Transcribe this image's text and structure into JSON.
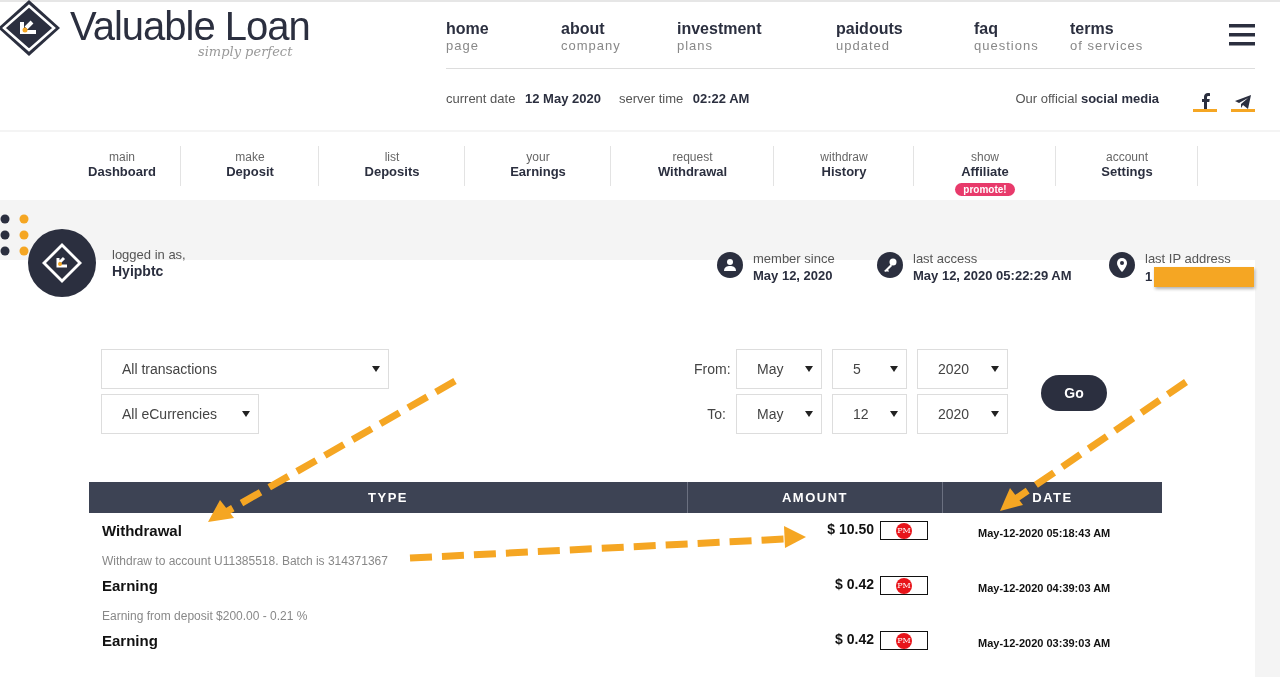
{
  "logo": {
    "name": "Valuable Loan",
    "tagline": "simply perfect"
  },
  "top_nav": [
    {
      "title": "home",
      "subtitle": "page"
    },
    {
      "title": "about",
      "subtitle": "company"
    },
    {
      "title": "investment",
      "subtitle": "plans"
    },
    {
      "title": "paidouts",
      "subtitle": "updated"
    },
    {
      "title": "faq",
      "subtitle": "questions"
    },
    {
      "title": "terms",
      "subtitle": "of services"
    }
  ],
  "info": [
    {
      "label": "current date",
      "value": "12 May 2020"
    },
    {
      "label": "server time",
      "value": "02:22 AM"
    }
  ],
  "social": {
    "text": "Our official **social media**",
    "icons": [
      {
        "kind": "facebook"
      },
      {
        "kind": "telegram"
      }
    ]
  },
  "account_nav": [
    {
      "top": "main",
      "bottom": "Dashboard"
    },
    {
      "top": "make",
      "bottom": "Deposit"
    },
    {
      "top": "list",
      "bottom": "Deposits"
    },
    {
      "top": "your",
      "bottom": "Earnings"
    },
    {
      "top": "request",
      "bottom": "Withdrawal"
    },
    {
      "top": "withdraw",
      "bottom": "History"
    },
    {
      "top": "show",
      "bottom": "Affiliate",
      "badge": "promote!"
    },
    {
      "top": "account",
      "bottom": "Settings"
    }
  ],
  "user": {
    "label": "logged in as,",
    "name": "Hyipbtc"
  },
  "stats": [
    {
      "kind": "member",
      "label": "member since",
      "value": "May 12, 2020"
    },
    {
      "kind": "access",
      "label": "last access",
      "value": "May 12, 2020 05:22:29 AM"
    },
    {
      "kind": "ip",
      "label": "last IP address",
      "value": "1",
      "redacted": true
    }
  ],
  "filters": {
    "type": "All transactions",
    "currency": "All eCurrencies",
    "ranges": [
      {
        "label": "From:",
        "month": "May",
        "day": "5",
        "year": "2020"
      },
      {
        "label": "To:",
        "month": "May",
        "day": "12",
        "year": "2020"
      }
    ],
    "button": "Go"
  },
  "table": {
    "columns": [
      "TYPE",
      "AMOUNT",
      "DATE"
    ],
    "rows": [
      {
        "type": "Withdrawal",
        "description": "Withdraw to account U11385518. Batch is 314371367",
        "amount": "$ 10.50",
        "processor": "PM",
        "date": "May-12-2020 05:18:43 AM"
      },
      {
        "type": "Earning",
        "description": "Earning from deposit $200.00 - 0.21 %",
        "amount": "$ 0.42",
        "processor": "PM",
        "date": "May-12-2020 04:39:03 AM"
      },
      {
        "type": "Earning",
        "amount": "$ 0.42",
        "processor": "PM",
        "date": "May-12-2020 03:39:03 AM"
      }
    ]
  }
}
